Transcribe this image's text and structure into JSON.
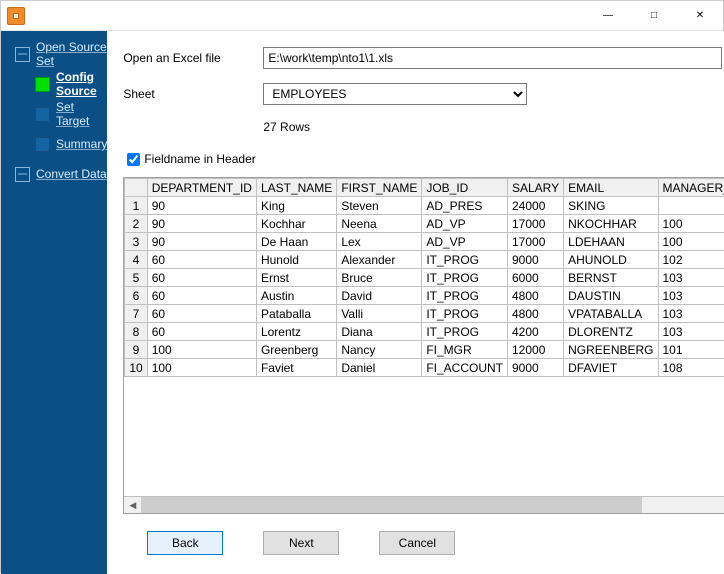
{
  "sidebar": {
    "open_source_set": "Open Source Set",
    "config_source": "Config Source",
    "set_target": "Set Target",
    "summary": "Summary",
    "convert_data": "Convert Data"
  },
  "form": {
    "open_excel_label": "Open an Excel file",
    "filepath": "E:\\work\\temp\\nto1\\1.xls",
    "sheet_label": "Sheet",
    "sheet_value": "EMPLOYEES",
    "rows_text": "27 Rows",
    "fieldname_label": "Fieldname in Header"
  },
  "table": {
    "headers": [
      "DEPARTMENT_ID",
      "LAST_NAME",
      "FIRST_NAME",
      "JOB_ID",
      "SALARY",
      "EMAIL",
      "MANAGER_ID"
    ],
    "rows": [
      {
        "n": "1",
        "dept": "90",
        "last": "King",
        "first": "Steven",
        "job": "AD_PRES",
        "sal": "24000",
        "email": "SKING",
        "mgr": ""
      },
      {
        "n": "2",
        "dept": "90",
        "last": "Kochhar",
        "first": "Neena",
        "job": "AD_VP",
        "sal": "17000",
        "email": "NKOCHHAR",
        "mgr": "100"
      },
      {
        "n": "3",
        "dept": "90",
        "last": "De Haan",
        "first": "Lex",
        "job": "AD_VP",
        "sal": "17000",
        "email": "LDEHAAN",
        "mgr": "100"
      },
      {
        "n": "4",
        "dept": "60",
        "last": "Hunold",
        "first": "Alexander",
        "job": "IT_PROG",
        "sal": "9000",
        "email": "AHUNOLD",
        "mgr": "102"
      },
      {
        "n": "5",
        "dept": "60",
        "last": "Ernst",
        "first": "Bruce",
        "job": "IT_PROG",
        "sal": "6000",
        "email": "BERNST",
        "mgr": "103"
      },
      {
        "n": "6",
        "dept": "60",
        "last": "Austin",
        "first": "David",
        "job": "IT_PROG",
        "sal": "4800",
        "email": "DAUSTIN",
        "mgr": "103"
      },
      {
        "n": "7",
        "dept": "60",
        "last": "Pataballa",
        "first": "Valli",
        "job": "IT_PROG",
        "sal": "4800",
        "email": "VPATABALLA",
        "mgr": "103"
      },
      {
        "n": "8",
        "dept": "60",
        "last": "Lorentz",
        "first": "Diana",
        "job": "IT_PROG",
        "sal": "4200",
        "email": "DLORENTZ",
        "mgr": "103"
      },
      {
        "n": "9",
        "dept": "100",
        "last": "Greenberg",
        "first": "Nancy",
        "job": "FI_MGR",
        "sal": "12000",
        "email": "NGREENBERG",
        "mgr": "101"
      },
      {
        "n": "10",
        "dept": "100",
        "last": "Faviet",
        "first": "Daniel",
        "job": "FI_ACCOUNT",
        "sal": "9000",
        "email": "DFAVIET",
        "mgr": "108"
      }
    ]
  },
  "buttons": {
    "back": "Back",
    "next": "Next",
    "cancel": "Cancel"
  }
}
